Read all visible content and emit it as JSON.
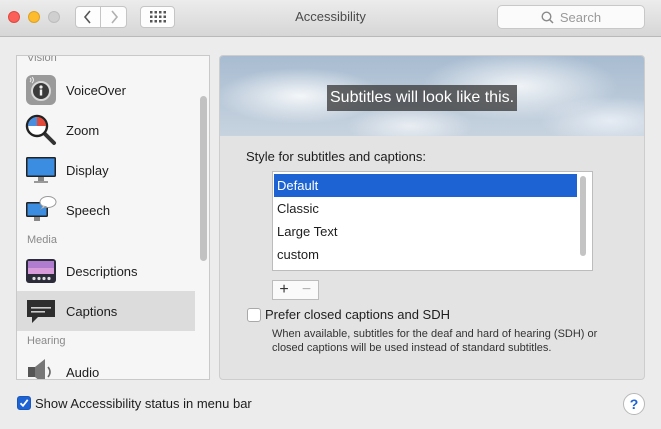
{
  "window": {
    "title": "Accessibility",
    "search_placeholder": "Search"
  },
  "sidebar": {
    "sections": {
      "vision": "Vision",
      "media": "Media",
      "hearing": "Hearing"
    },
    "items": [
      {
        "label": "VoiceOver",
        "icon": "voiceover-icon"
      },
      {
        "label": "Zoom",
        "icon": "zoom-icon"
      },
      {
        "label": "Display",
        "icon": "display-icon"
      },
      {
        "label": "Speech",
        "icon": "speech-icon"
      },
      {
        "label": "Descriptions",
        "icon": "descriptions-icon"
      },
      {
        "label": "Captions",
        "icon": "captions-icon",
        "selected": true
      },
      {
        "label": "Audio",
        "icon": "audio-icon"
      }
    ]
  },
  "captions": {
    "preview_text": "Subtitles will look like this.",
    "style_label": "Style for subtitles and captions:",
    "styles": [
      "Default",
      "Classic",
      "Large Text",
      "custom"
    ],
    "selected_style": "Default",
    "plus_label": "+",
    "minus_label": "−",
    "sdh_label": "Prefer closed captions and SDH",
    "sdh_checked": false,
    "sdh_description": "When available, subtitles for the deaf and hard of hearing (SDH) or closed captions will be used instead of standard subtitles."
  },
  "footer": {
    "status_label": "Show Accessibility status in menu bar",
    "status_checked": true,
    "help_label": "?"
  },
  "colors": {
    "selection": "#1d63d3",
    "close": "#fc5f57",
    "minimize": "#fdbc2e"
  }
}
